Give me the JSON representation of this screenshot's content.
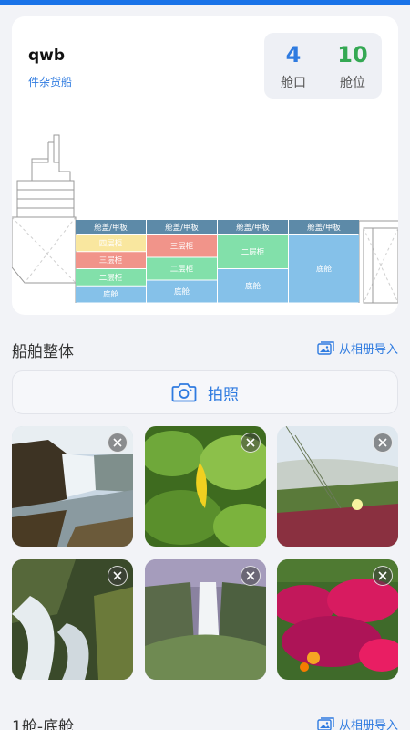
{
  "ship": {
    "name": "qwb",
    "type": "件杂货船",
    "stats": [
      {
        "value": "4",
        "label": "舱口"
      },
      {
        "value": "10",
        "label": "舱位"
      }
    ]
  },
  "holds": [
    {
      "header": "舱盖/甲板",
      "levels": [
        "四层柜",
        "三层柜",
        "二层柜",
        "底舱"
      ]
    },
    {
      "header": "舱盖/甲板",
      "levels": [
        "三层柜",
        "二层柜",
        "底舱"
      ]
    },
    {
      "header": "舱盖/甲板",
      "levels": [
        "二层柜",
        "底舱"
      ]
    },
    {
      "header": "舱盖/甲板",
      "levels": [
        "底舱"
      ]
    }
  ],
  "level_colors": {
    "四层柜": "#f9e79f",
    "三层柜": "#f1948a",
    "二层柜": "#82e0aa",
    "底舱": "#85c1e9",
    "header": "#5d8aa8"
  },
  "section_overall": {
    "title": "船舶整体",
    "import_label": "从相册导入",
    "photo_button": "拍照"
  },
  "photos": [
    {
      "icon": "waterfall-photo",
      "close": "remove-icon"
    },
    {
      "icon": "leaf-photo",
      "close": "remove-icon"
    },
    {
      "icon": "meadow-flower-photo",
      "close": "remove-icon"
    },
    {
      "icon": "rapids-photo",
      "close": "remove-icon"
    },
    {
      "icon": "mist-waterfall-photo",
      "close": "remove-icon"
    },
    {
      "icon": "flowers-photo",
      "close": "remove-icon"
    }
  ],
  "section_hold1": {
    "title": "1舱-底舱",
    "import_label": "从相册导入"
  },
  "colors": {
    "accent": "#2f7be0",
    "green": "#34a853",
    "topbar": "#1a73e8"
  }
}
